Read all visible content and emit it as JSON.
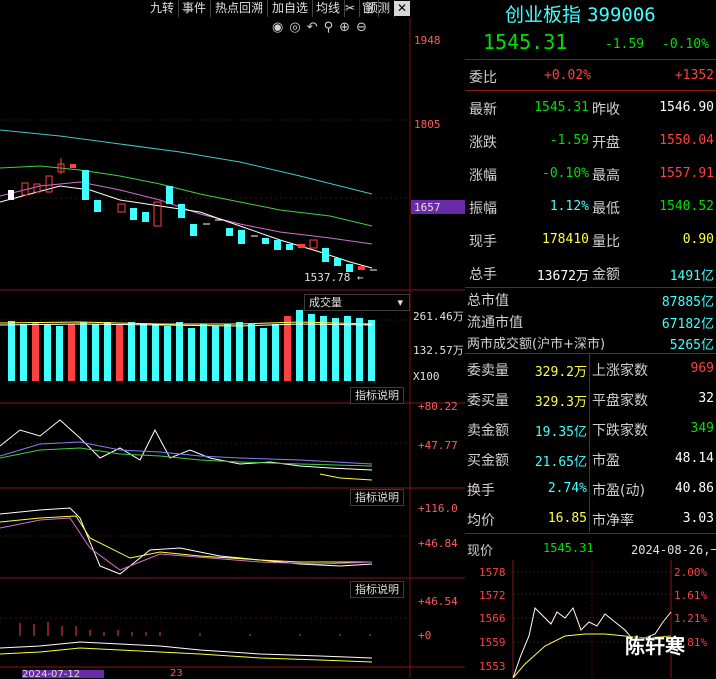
{
  "toolbar": {
    "items": [
      "九转",
      "事件",
      "热点回溯",
      "加自选",
      "均线",
      "✂",
      "窗",
      "预测"
    ],
    "close": "✕"
  },
  "chart": {
    "price_axis": [
      "1948",
      "1805",
      "1657"
    ],
    "low_label": "1537.78",
    "volume_selector": "成交量",
    "volume_axis": [
      "261.46万",
      "132.57万",
      "X100"
    ],
    "indicator_label": "指标说明",
    "ind1_axis": [
      "+80.22",
      "+47.77"
    ],
    "ind2_axis": [
      "+116.0",
      "+46.84"
    ],
    "ind3_axis": [
      "+46.54",
      "+0"
    ],
    "bottom_date": "2024-07-12",
    "bottom_num": "23"
  },
  "colors": {
    "up": "#ff4040",
    "down": "#40ffff",
    "flat": "#ffffff",
    "grid": "#7a1010",
    "accent_purple": "#6a2aa8"
  },
  "panel": {
    "title": "创业板指",
    "code": "399006",
    "price": "1545.31",
    "change": "-1.59",
    "change_pct": "-0.10%",
    "weibi_label": "委比",
    "weibi_pct": "+0.02%",
    "weibi_val": "+1352",
    "rows": [
      {
        "l1": "最新",
        "v1": "1545.31",
        "l2": "昨收",
        "v2": "1546.90"
      },
      {
        "l1": "涨跌",
        "v1": "-1.59",
        "l2": "开盘",
        "v2": "1550.04"
      },
      {
        "l1": "涨幅",
        "v1": "-0.10%",
        "l2": "最高",
        "v2": "1557.91"
      },
      {
        "l1": "振幅",
        "v1": "1.12%",
        "l2": "最低",
        "v2": "1540.52"
      },
      {
        "l1": "现手",
        "v1": "178410",
        "l2": "量比",
        "v2": "0.90"
      },
      {
        "l1": "总手",
        "v1": "13672万",
        "l2": "金额",
        "v2": "1491亿"
      }
    ],
    "cap_rows": [
      {
        "l": "总市值",
        "v": "87885亿"
      },
      {
        "l": "流通市值",
        "v": "67182亿"
      },
      {
        "l": "两市成交额(沪市+深市)",
        "v": "5265亿"
      }
    ],
    "stats": [
      {
        "l1": "委卖量",
        "v1": "329.2万",
        "l2": "上涨家数",
        "v2": "969"
      },
      {
        "l1": "委买量",
        "v1": "329.3万",
        "l2": "平盘家数",
        "v2": "32"
      },
      {
        "l1": "卖金额",
        "v1": "19.35亿",
        "l2": "下跌家数",
        "v2": "349"
      },
      {
        "l1": "买金额",
        "v1": "21.65亿",
        "l2": "市盈",
        "v2": "48.14"
      },
      {
        "l1": "换手",
        "v1": "2.74%",
        "l2": "市盈(动)",
        "v2": "40.86"
      },
      {
        "l1": "均价",
        "v1": "16.85",
        "l2": "市净率",
        "v2": "3.03"
      }
    ],
    "minute": {
      "label": "现价",
      "price": "1545.31",
      "date": "2024-08-26,一",
      "left_axis": [
        "1578",
        "1572",
        "1566",
        "1559",
        "1553"
      ],
      "right_axis": [
        "2.00%",
        "1.61%",
        "1.21%",
        "0.81%"
      ]
    },
    "watermark": "陈轩寒"
  }
}
